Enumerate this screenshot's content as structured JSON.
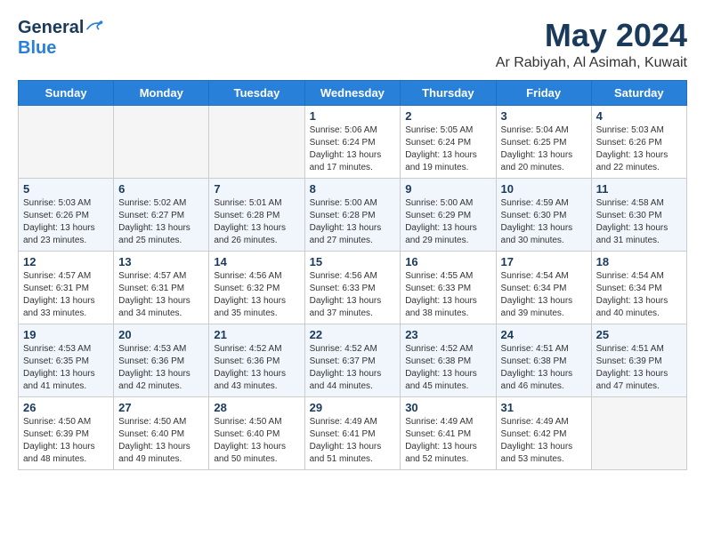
{
  "header": {
    "logo_general": "General",
    "logo_blue": "Blue",
    "month": "May 2024",
    "location": "Ar Rabiyah, Al Asimah, Kuwait"
  },
  "days_of_week": [
    "Sunday",
    "Monday",
    "Tuesday",
    "Wednesday",
    "Thursday",
    "Friday",
    "Saturday"
  ],
  "weeks": [
    [
      {
        "day": "",
        "empty": true
      },
      {
        "day": "",
        "empty": true
      },
      {
        "day": "",
        "empty": true
      },
      {
        "day": "1",
        "sunrise": "5:06 AM",
        "sunset": "6:24 PM",
        "daylight": "13 hours and 17 minutes."
      },
      {
        "day": "2",
        "sunrise": "5:05 AM",
        "sunset": "6:24 PM",
        "daylight": "13 hours and 19 minutes."
      },
      {
        "day": "3",
        "sunrise": "5:04 AM",
        "sunset": "6:25 PM",
        "daylight": "13 hours and 20 minutes."
      },
      {
        "day": "4",
        "sunrise": "5:03 AM",
        "sunset": "6:26 PM",
        "daylight": "13 hours and 22 minutes."
      }
    ],
    [
      {
        "day": "5",
        "sunrise": "5:03 AM",
        "sunset": "6:26 PM",
        "daylight": "13 hours and 23 minutes."
      },
      {
        "day": "6",
        "sunrise": "5:02 AM",
        "sunset": "6:27 PM",
        "daylight": "13 hours and 25 minutes."
      },
      {
        "day": "7",
        "sunrise": "5:01 AM",
        "sunset": "6:28 PM",
        "daylight": "13 hours and 26 minutes."
      },
      {
        "day": "8",
        "sunrise": "5:00 AM",
        "sunset": "6:28 PM",
        "daylight": "13 hours and 27 minutes."
      },
      {
        "day": "9",
        "sunrise": "5:00 AM",
        "sunset": "6:29 PM",
        "daylight": "13 hours and 29 minutes."
      },
      {
        "day": "10",
        "sunrise": "4:59 AM",
        "sunset": "6:30 PM",
        "daylight": "13 hours and 30 minutes."
      },
      {
        "day": "11",
        "sunrise": "4:58 AM",
        "sunset": "6:30 PM",
        "daylight": "13 hours and 31 minutes."
      }
    ],
    [
      {
        "day": "12",
        "sunrise": "4:57 AM",
        "sunset": "6:31 PM",
        "daylight": "13 hours and 33 minutes."
      },
      {
        "day": "13",
        "sunrise": "4:57 AM",
        "sunset": "6:31 PM",
        "daylight": "13 hours and 34 minutes."
      },
      {
        "day": "14",
        "sunrise": "4:56 AM",
        "sunset": "6:32 PM",
        "daylight": "13 hours and 35 minutes."
      },
      {
        "day": "15",
        "sunrise": "4:56 AM",
        "sunset": "6:33 PM",
        "daylight": "13 hours and 37 minutes."
      },
      {
        "day": "16",
        "sunrise": "4:55 AM",
        "sunset": "6:33 PM",
        "daylight": "13 hours and 38 minutes."
      },
      {
        "day": "17",
        "sunrise": "4:54 AM",
        "sunset": "6:34 PM",
        "daylight": "13 hours and 39 minutes."
      },
      {
        "day": "18",
        "sunrise": "4:54 AM",
        "sunset": "6:34 PM",
        "daylight": "13 hours and 40 minutes."
      }
    ],
    [
      {
        "day": "19",
        "sunrise": "4:53 AM",
        "sunset": "6:35 PM",
        "daylight": "13 hours and 41 minutes."
      },
      {
        "day": "20",
        "sunrise": "4:53 AM",
        "sunset": "6:36 PM",
        "daylight": "13 hours and 42 minutes."
      },
      {
        "day": "21",
        "sunrise": "4:52 AM",
        "sunset": "6:36 PM",
        "daylight": "13 hours and 43 minutes."
      },
      {
        "day": "22",
        "sunrise": "4:52 AM",
        "sunset": "6:37 PM",
        "daylight": "13 hours and 44 minutes."
      },
      {
        "day": "23",
        "sunrise": "4:52 AM",
        "sunset": "6:38 PM",
        "daylight": "13 hours and 45 minutes."
      },
      {
        "day": "24",
        "sunrise": "4:51 AM",
        "sunset": "6:38 PM",
        "daylight": "13 hours and 46 minutes."
      },
      {
        "day": "25",
        "sunrise": "4:51 AM",
        "sunset": "6:39 PM",
        "daylight": "13 hours and 47 minutes."
      }
    ],
    [
      {
        "day": "26",
        "sunrise": "4:50 AM",
        "sunset": "6:39 PM",
        "daylight": "13 hours and 48 minutes."
      },
      {
        "day": "27",
        "sunrise": "4:50 AM",
        "sunset": "6:40 PM",
        "daylight": "13 hours and 49 minutes."
      },
      {
        "day": "28",
        "sunrise": "4:50 AM",
        "sunset": "6:40 PM",
        "daylight": "13 hours and 50 minutes."
      },
      {
        "day": "29",
        "sunrise": "4:49 AM",
        "sunset": "6:41 PM",
        "daylight": "13 hours and 51 minutes."
      },
      {
        "day": "30",
        "sunrise": "4:49 AM",
        "sunset": "6:41 PM",
        "daylight": "13 hours and 52 minutes."
      },
      {
        "day": "31",
        "sunrise": "4:49 AM",
        "sunset": "6:42 PM",
        "daylight": "13 hours and 53 minutes."
      },
      {
        "day": "",
        "empty": true
      }
    ]
  ],
  "labels": {
    "sunrise": "Sunrise:",
    "sunset": "Sunset:",
    "daylight": "Daylight:"
  }
}
